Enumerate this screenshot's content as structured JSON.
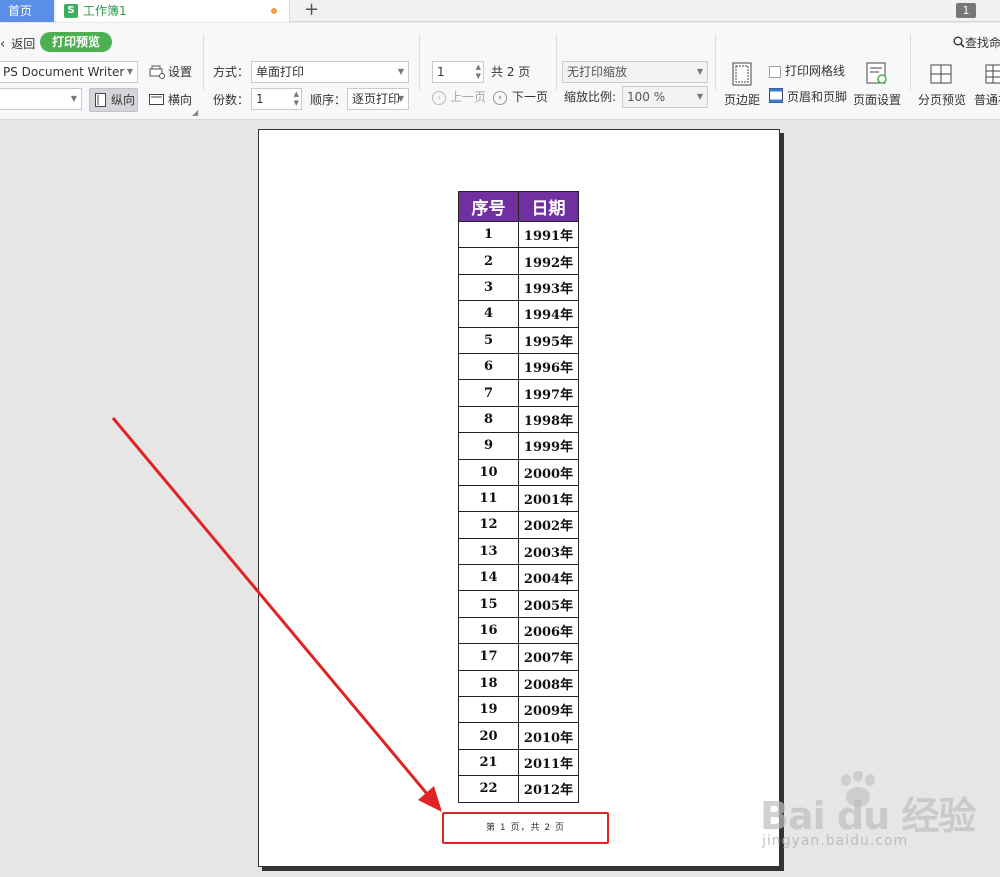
{
  "tabs": {
    "home": "首页",
    "workbook_icon": "S",
    "workbook": "工作簿1",
    "add": "+",
    "window_count": "1"
  },
  "toolbar": {
    "back": "返回",
    "print_preview": "打印预览",
    "find": "查找命",
    "printer": "PS Document Writer",
    "settings": "设置",
    "paper": "",
    "portrait": "纵向",
    "landscape": "横向",
    "mode_label": "方式：",
    "mode_value": "单面打印",
    "copies_label": "份数：",
    "copies_value": "1",
    "order_label": "顺序：",
    "order_value": "逐页打印",
    "page_value": "1",
    "page_total": "共 2 页",
    "prev": "上一页",
    "next": "下一页",
    "scale_mode": "无打印缩放",
    "scale_label": "缩放比例:",
    "scale_value": "100 %",
    "margins": "页边距",
    "gridlines": "打印网格线",
    "header_footer": "页眉和页脚",
    "page_setup": "页面设置",
    "page_break_preview": "分页预览",
    "normal_view": "普通视"
  },
  "sheet": {
    "headers": [
      "序号",
      "日期"
    ],
    "rows": [
      [
        "1",
        "1991年"
      ],
      [
        "2",
        "1992年"
      ],
      [
        "3",
        "1993年"
      ],
      [
        "4",
        "1994年"
      ],
      [
        "5",
        "1995年"
      ],
      [
        "6",
        "1996年"
      ],
      [
        "7",
        "1997年"
      ],
      [
        "8",
        "1998年"
      ],
      [
        "9",
        "1999年"
      ],
      [
        "10",
        "2000年"
      ],
      [
        "11",
        "2001年"
      ],
      [
        "12",
        "2002年"
      ],
      [
        "13",
        "2003年"
      ],
      [
        "14",
        "2004年"
      ],
      [
        "15",
        "2005年"
      ],
      [
        "16",
        "2006年"
      ],
      [
        "17",
        "2007年"
      ],
      [
        "18",
        "2008年"
      ],
      [
        "19",
        "2009年"
      ],
      [
        "20",
        "2010年"
      ],
      [
        "21",
        "2011年"
      ],
      [
        "22",
        "2012年"
      ]
    ],
    "footer": "第 1 页，共 2 页"
  },
  "watermark": {
    "logo": "Bai du 经验",
    "url": "jingyan.baidu.com"
  },
  "colors": {
    "header_fill": "#7030a0",
    "annotation": "#e02424",
    "accent_green": "#4caf50",
    "tab_blue": "#5b8ee6"
  }
}
